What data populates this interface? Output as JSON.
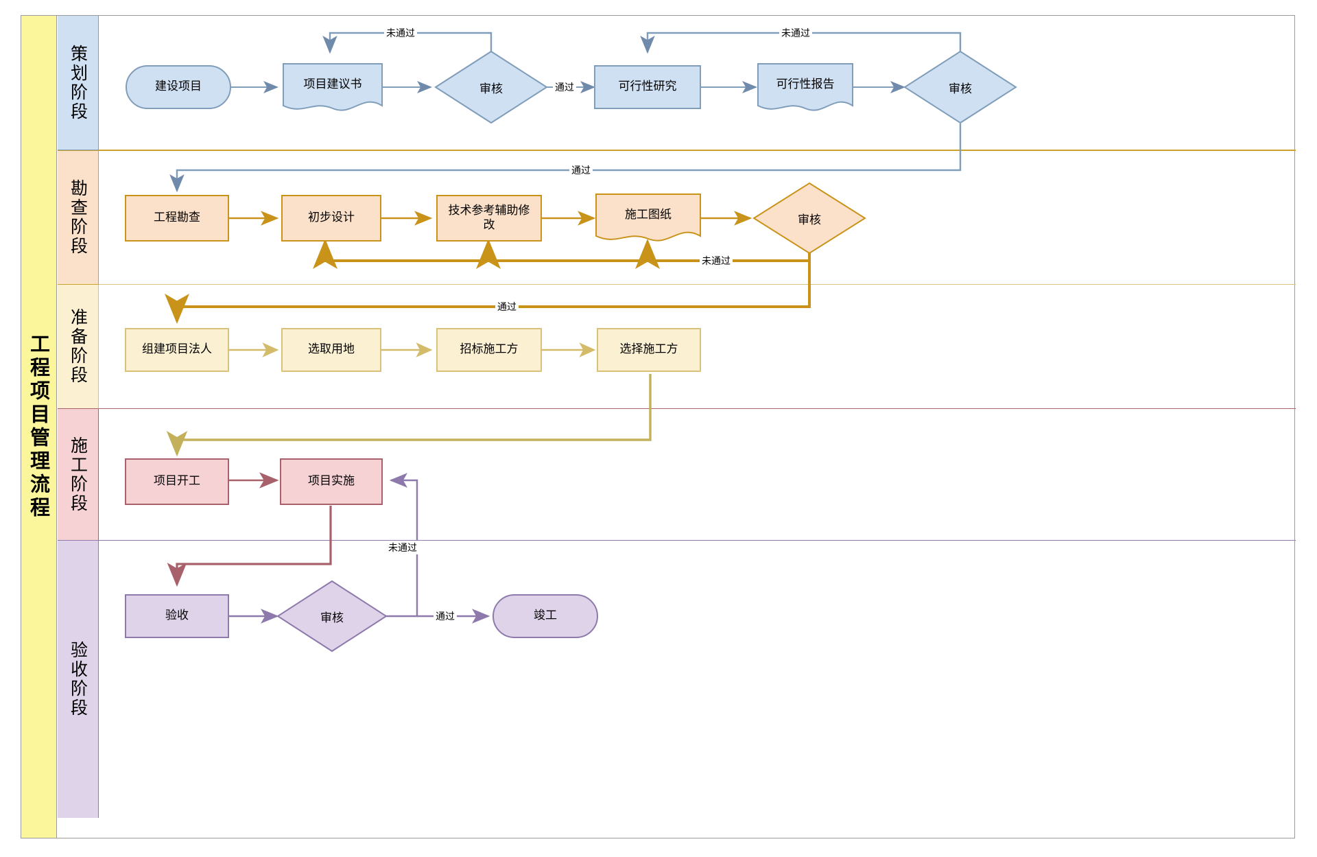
{
  "diagram": {
    "title": "工程项目管理流程",
    "type": "swimlane-flowchart"
  },
  "colors": {
    "title_bg": "#fbf69b",
    "lane1_bg": "#cfe0f3",
    "lane1_stroke": "#7f9db9",
    "lane1_node": "#cfe0f3",
    "lane2_bg": "#fbe0ca",
    "lane2_stroke": "#c9a227",
    "lane2_node": "#fbe0ca",
    "lane3_bg": "#fcf0d3",
    "lane3_stroke": "#d9c179",
    "lane3_node": "#fcf0d3",
    "lane4_bg": "#f6d2d5",
    "lane4_stroke": "#a8606a",
    "lane4_node": "#f6d2d5",
    "lane5_bg": "#ded3e8",
    "lane5_stroke": "#8d79ab",
    "lane5_node": "#ded3e8",
    "frame_stroke": "#9a9a9a"
  },
  "lanes": [
    {
      "id": "lane-planning",
      "label": "策划阶段",
      "nodes": [
        {
          "id": "n-construction-project",
          "label": "建设项目",
          "shape": "rounded"
        },
        {
          "id": "n-project-proposal",
          "label": "项目建议书",
          "shape": "document"
        },
        {
          "id": "n-review-1",
          "label": "审核",
          "shape": "diamond"
        },
        {
          "id": "n-feasibility-study",
          "label": "可行性研究",
          "shape": "process"
        },
        {
          "id": "n-feasibility-report",
          "label": "可行性报告",
          "shape": "document"
        },
        {
          "id": "n-review-2",
          "label": "审核",
          "shape": "diamond"
        }
      ],
      "edge_labels": [
        "未通过",
        "通过",
        "未通过"
      ]
    },
    {
      "id": "lane-survey",
      "label": "勘查阶段",
      "nodes": [
        {
          "id": "n-engineering-survey",
          "label": "工程勘查",
          "shape": "process"
        },
        {
          "id": "n-preliminary-design",
          "label": "初步设计",
          "shape": "process"
        },
        {
          "id": "n-technical-revision",
          "label": "技术参考辅助修改",
          "shape": "process"
        },
        {
          "id": "n-construction-drawings",
          "label": "施工图纸",
          "shape": "document"
        },
        {
          "id": "n-review-3",
          "label": "审核",
          "shape": "diamond"
        }
      ],
      "edge_labels": [
        "通过",
        "未通过"
      ]
    },
    {
      "id": "lane-preparation",
      "label": "准备阶段",
      "nodes": [
        {
          "id": "n-form-legal-entity",
          "label": "组建项目法人",
          "shape": "process"
        },
        {
          "id": "n-select-land",
          "label": "选取用地",
          "shape": "process"
        },
        {
          "id": "n-tender-contractor",
          "label": "招标施工方",
          "shape": "process"
        },
        {
          "id": "n-choose-contractor",
          "label": "选择施工方",
          "shape": "process"
        }
      ],
      "edge_labels": [
        "通过"
      ]
    },
    {
      "id": "lane-construction",
      "label": "施工阶段",
      "nodes": [
        {
          "id": "n-project-start",
          "label": "项目开工",
          "shape": "process"
        },
        {
          "id": "n-project-implementation",
          "label": "项目实施",
          "shape": "process"
        }
      ],
      "edge_labels": []
    },
    {
      "id": "lane-acceptance",
      "label": "验收阶段",
      "nodes": [
        {
          "id": "n-acceptance",
          "label": "验收",
          "shape": "process"
        },
        {
          "id": "n-review-4",
          "label": "审核",
          "shape": "diamond"
        },
        {
          "id": "n-completion",
          "label": "竣工",
          "shape": "rounded"
        }
      ],
      "edge_labels": [
        "未通过",
        "通过"
      ]
    }
  ],
  "edge_labels": {
    "l1_fail_1": "未通过",
    "l1_pass_1": "通过",
    "l1_fail_2": "未通过",
    "l2_pass": "通过",
    "l2_fail": "未通过",
    "l3_pass": "通过",
    "l5_fail": "未通过",
    "l5_pass": "通过"
  }
}
